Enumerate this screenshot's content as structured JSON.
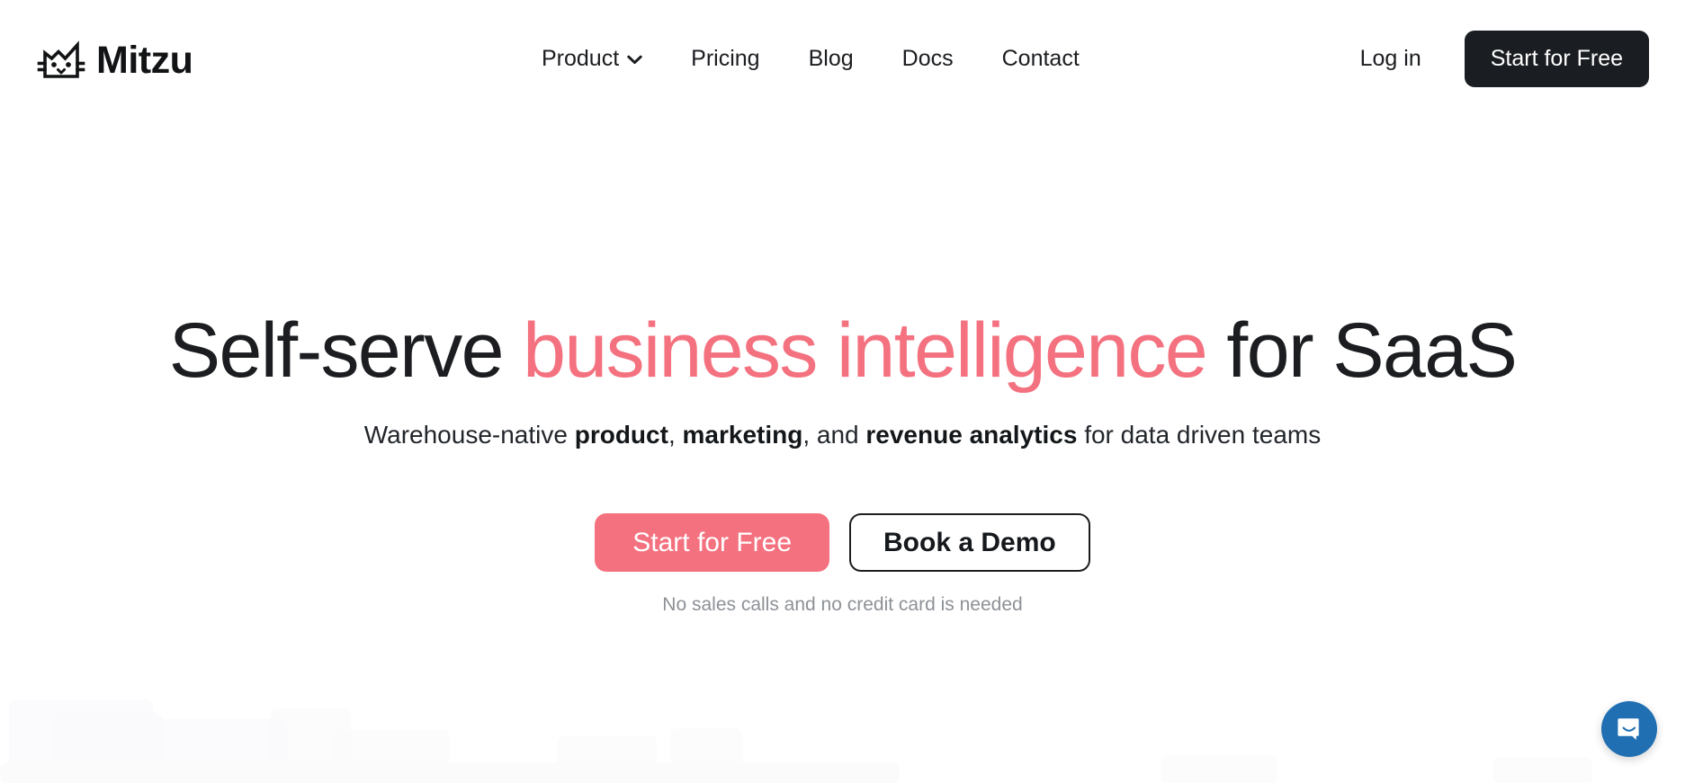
{
  "brand": {
    "name": "Mitzu",
    "logo_icon": "cat-face-icon"
  },
  "nav": {
    "items": [
      {
        "label": "Product",
        "has_dropdown": true,
        "icon": "chevron-down-icon"
      },
      {
        "label": "Pricing",
        "has_dropdown": false
      },
      {
        "label": "Blog",
        "has_dropdown": false
      },
      {
        "label": "Docs",
        "has_dropdown": false
      },
      {
        "label": "Contact",
        "has_dropdown": false
      }
    ]
  },
  "header_actions": {
    "login_label": "Log in",
    "cta_label": "Start for Free"
  },
  "hero": {
    "title_part1": "Self-serve ",
    "title_accent": "business intelligence",
    "title_part2": " for SaaS",
    "sub_part1": "Warehouse-native ",
    "sub_bold1": "product",
    "sub_part2": ", ",
    "sub_bold2": "marketing",
    "sub_part3": ", and ",
    "sub_bold3": "revenue analytics",
    "sub_part4": " for data driven teams",
    "primary_cta": "Start for Free",
    "secondary_cta": "Book a Demo",
    "note": "No sales calls and no credit card is needed"
  },
  "chat": {
    "icon": "chat-bubble-smile-icon",
    "color": "#1f6fb2"
  },
  "colors": {
    "accent": "#f4717f",
    "dark": "#1a1d21",
    "text": "#1b1d20",
    "muted": "#8d9196",
    "background": "#ffffff"
  }
}
